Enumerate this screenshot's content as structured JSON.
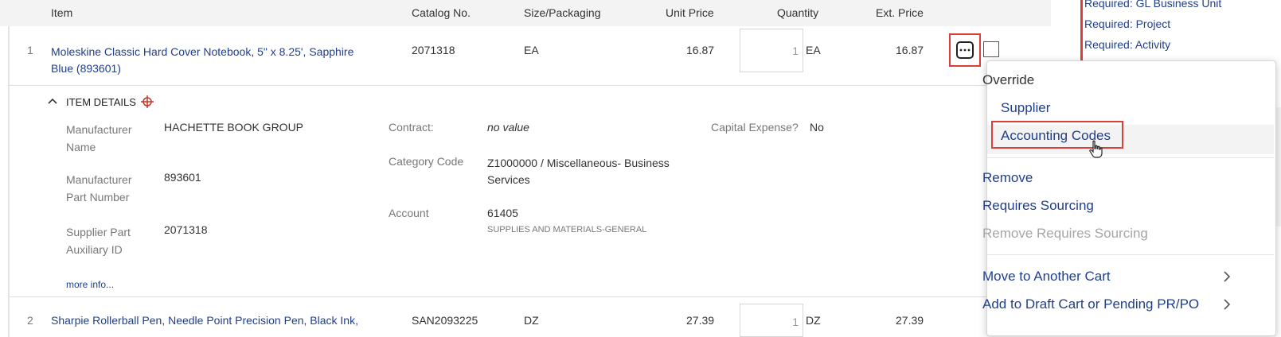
{
  "header": {
    "item": "Item",
    "catalog": "Catalog No.",
    "size": "Size/Packaging",
    "unit_price": "Unit Price",
    "quantity": "Quantity",
    "ext_price": "Ext. Price"
  },
  "rows": [
    {
      "num": "1",
      "name_line1": "Moleskine Classic Hard Cover Notebook, 5\" x 8.25', Sapphire",
      "name_line2": "Blue (893601)",
      "catalog": "2071318",
      "size": "EA",
      "unit_price": "16.87",
      "qty": "1",
      "uom": "EA",
      "ext_price": "16.87"
    },
    {
      "num": "2",
      "name_line1": "Sharpie Rollerball Pen, Needle Point Precision Pen, Black Ink,",
      "catalog": "SAN2093225",
      "size": "DZ",
      "unit_price": "27.39",
      "qty": "1",
      "uom": "DZ",
      "ext_price": "27.39"
    }
  ],
  "details": {
    "toggle_label": "ITEM DETAILS",
    "mfr_name_label_1": "Manufacturer",
    "mfr_name_label_2": "Name",
    "mfr_name_value": "HACHETTE BOOK GROUP",
    "mfr_part_label_1": "Manufacturer",
    "mfr_part_label_2": "Part Number",
    "mfr_part_value": "893601",
    "supplier_aux_label_1": "Supplier Part",
    "supplier_aux_label_2": "Auxiliary ID",
    "supplier_aux_value": "2071318",
    "contract_label": "Contract:",
    "contract_value": "no value",
    "category_label": "Category Code",
    "category_value_1": "Z1000000 / Miscellaneous- Business",
    "category_value_2": "Services",
    "account_label": "Account",
    "account_value": "61405",
    "account_desc": "SUPPLIES AND MATERIALS-GENERAL",
    "capital_label": "Capital Expense?",
    "capital_value": "No",
    "more_info": "more info..."
  },
  "side_panel": {
    "req1": "Required: GL Business Unit",
    "req2": "Required: Project",
    "req3": "Required: Activity"
  },
  "menu": {
    "override": "Override",
    "supplier": "Supplier",
    "accounting_codes": "Accounting Codes",
    "remove": "Remove",
    "requires_sourcing": "Requires Sourcing",
    "remove_requires_sourcing": "Remove Requires Sourcing",
    "move_to_cart": "Move to Another Cart",
    "add_to_draft": "Add to Draft Cart or Pending PR/PO"
  },
  "icons": {
    "actions": "ellipsis-icon",
    "collapse": "chevron-up-icon",
    "details": "crosshair-icon",
    "submenu": "chevron-right-icon",
    "cursor": "hand-cursor-icon"
  },
  "colors": {
    "link": "#1f3f8c",
    "highlight_border": "#d9403a",
    "header_bg": "#f3f3f3"
  }
}
